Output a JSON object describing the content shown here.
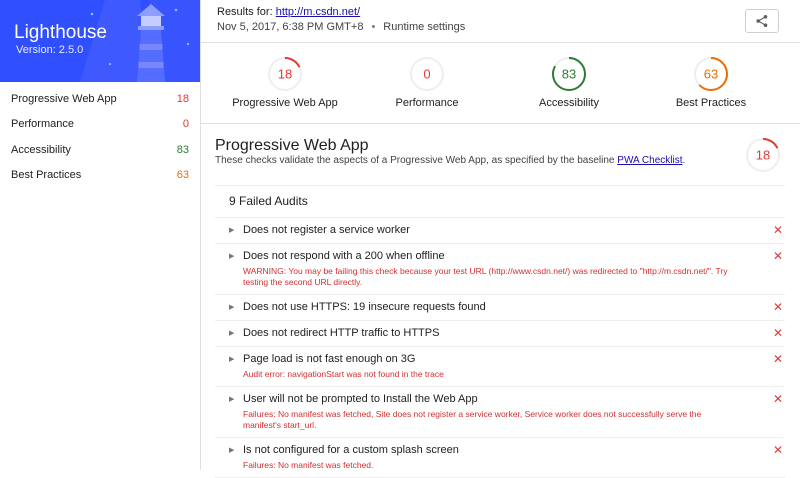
{
  "brand": {
    "title": "Lighthouse",
    "version": "Version: 2.5.0",
    "color": "#304ffe"
  },
  "categories": [
    {
      "label": "Progressive Web App",
      "score": "18",
      "color": "#e53935"
    },
    {
      "label": "Performance",
      "score": "0",
      "color": "#e53935"
    },
    {
      "label": "Accessibility",
      "score": "83",
      "color": "#2e7d32"
    },
    {
      "label": "Best Practices",
      "score": "63",
      "color": "#ef6c00"
    }
  ],
  "header": {
    "results_prefix": "Results for:",
    "url": "http://m.csdn.net/",
    "timestamp": "Nov 5, 2017, 6:38 PM GMT+8",
    "separator": "•",
    "runtime_settings": "Runtime settings"
  },
  "gauges": [
    {
      "label": "Progressive Web App",
      "score": "18",
      "fraction": 0.18,
      "color": "#e53935"
    },
    {
      "label": "Performance",
      "score": "0",
      "fraction": 0.0,
      "color": "#e53935"
    },
    {
      "label": "Accessibility",
      "score": "83",
      "fraction": 0.83,
      "color": "#2e7d32"
    },
    {
      "label": "Best Practices",
      "score": "63",
      "fraction": 0.63,
      "color": "#ef6c00"
    }
  ],
  "section": {
    "title": "Progressive Web App",
    "description": "These checks validate the aspects of a Progressive Web App, as specified by the baseline",
    "link_text": "PWA Checklist",
    "description_end": ".",
    "score": "18",
    "fraction": 0.18,
    "color": "#e53935"
  },
  "audits": {
    "heading": "9 Failed Audits",
    "items": [
      {
        "title": "Does not register a service worker",
        "detail": ""
      },
      {
        "title": "Does not respond with a 200 when offline",
        "detail": "WARNING: You may be failing this check because your test URL (http://www.csdn.net/) was redirected to \"http://m.csdn.net/\". Try testing the second URL directly."
      },
      {
        "title": "Does not use HTTPS: 19 insecure requests found",
        "detail": ""
      },
      {
        "title": "Does not redirect HTTP traffic to HTTPS",
        "detail": ""
      },
      {
        "title": "Page load is not fast enough on 3G",
        "detail": "Audit error: navigationStart was not found in the trace"
      },
      {
        "title": "User will not be prompted to Install the Web App",
        "detail": "Failures: No manifest was fetched, Site does not register a service worker, Service worker does not successfully serve the manifest's start_url."
      },
      {
        "title": "Is not configured for a custom splash screen",
        "detail": "Failures: No manifest was fetched."
      }
    ]
  },
  "icons": {
    "share": "share-icon",
    "expand": "triangle-right-icon",
    "fail": "x-icon"
  },
  "fail_mark": "✕",
  "expand_mark": "▶"
}
